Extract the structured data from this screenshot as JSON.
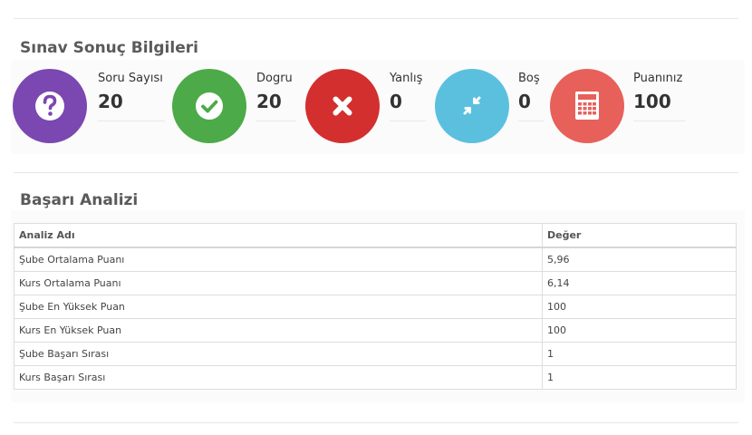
{
  "sonuc": {
    "title": "Sınav Sonuç Bilgileri",
    "stats": [
      {
        "label": "Soru Sayısı",
        "value": "20",
        "color": "#7b47b0",
        "icon": "question-icon"
      },
      {
        "label": "Dogru",
        "value": "20",
        "color": "#4caa48",
        "icon": "check-icon"
      },
      {
        "label": "Yanlış",
        "value": "0",
        "color": "#d32f2f",
        "icon": "close-icon"
      },
      {
        "label": "Boş",
        "value": "0",
        "color": "#5bc0de",
        "icon": "compress-icon"
      },
      {
        "label": "Puanınız",
        "value": "100",
        "color": "#e8605a",
        "icon": "calculator-icon"
      }
    ]
  },
  "analiz": {
    "title": "Başarı Analizi",
    "columns": [
      "Analiz Adı",
      "Değer"
    ],
    "rows": [
      [
        "Şube Ortalama Puanı",
        "5,96"
      ],
      [
        "Kurs Ortalama Puanı",
        "6,14"
      ],
      [
        "Şube En Yüksek Puan",
        "100"
      ],
      [
        "Kurs En Yüksek Puan",
        "100"
      ],
      [
        "Şube Başarı Sırası",
        "1"
      ],
      [
        "Kurs Başarı Sırası",
        "1"
      ]
    ]
  }
}
